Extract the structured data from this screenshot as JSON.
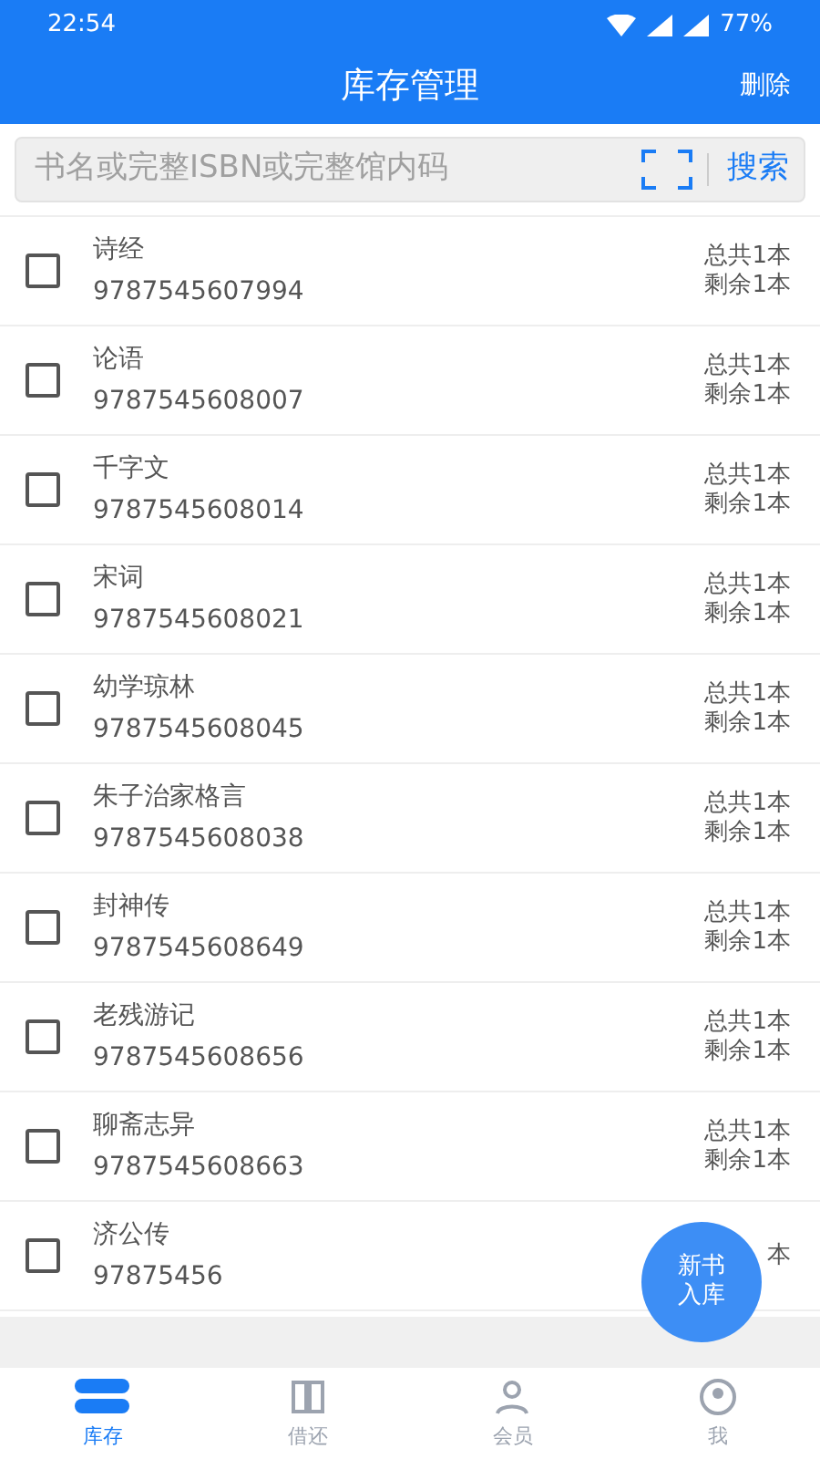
{
  "status_bar": {
    "time": "22:54",
    "battery": "77%"
  },
  "header": {
    "title": "库存管理",
    "action": "删除"
  },
  "search": {
    "placeholder": "书名或完整ISBN或完整馆内码",
    "button": "搜索"
  },
  "books": [
    {
      "title": "诗经",
      "isbn": "9787545607994",
      "total": "总共1本",
      "remaining": "剩余1本",
      "checked": false
    },
    {
      "title": "论语",
      "isbn": "9787545608007",
      "total": "总共1本",
      "remaining": "剩余1本",
      "checked": false
    },
    {
      "title": "千字文",
      "isbn": "9787545608014",
      "total": "总共1本",
      "remaining": "剩余1本",
      "checked": false
    },
    {
      "title": "宋词",
      "isbn": "9787545608021",
      "total": "总共1本",
      "remaining": "剩余1本",
      "checked": false
    },
    {
      "title": "幼学琼林",
      "isbn": "9787545608045",
      "total": "总共1本",
      "remaining": "剩余1本",
      "checked": false
    },
    {
      "title": "朱子治家格言",
      "isbn": "9787545608038",
      "total": "总共1本",
      "remaining": "剩余1本",
      "checked": false
    },
    {
      "title": "封神传",
      "isbn": "9787545608649",
      "total": "总共1本",
      "remaining": "剩余1本",
      "checked": false
    },
    {
      "title": "老残游记",
      "isbn": "9787545608656",
      "total": "总共1本",
      "remaining": "剩余1本",
      "checked": false
    },
    {
      "title": "聊斋志异",
      "isbn": "9787545608663",
      "total": "总共1本",
      "remaining": "剩余1本",
      "checked": false
    },
    {
      "title": "济公传",
      "isbn": "97875456",
      "total": "本",
      "checked": false
    }
  ],
  "fab": {
    "line1": "新书",
    "line2": "入库"
  },
  "tabs": [
    {
      "label": "库存",
      "selected": true
    },
    {
      "label": "借还",
      "selected": false
    },
    {
      "label": "会员",
      "selected": false
    },
    {
      "label": "我",
      "selected": false
    }
  ]
}
